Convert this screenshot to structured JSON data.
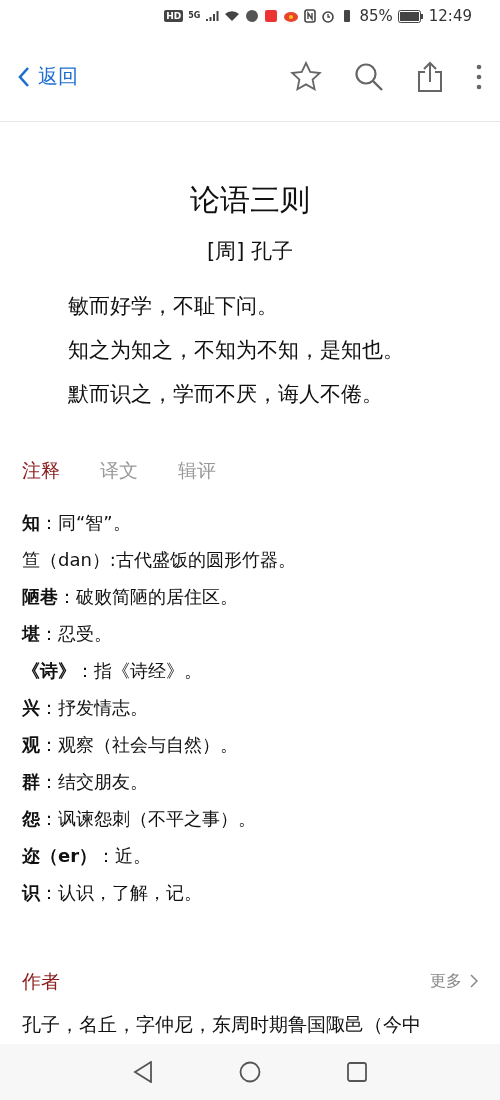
{
  "status_bar": {
    "badge": "HD",
    "network": "5G",
    "battery": "85%",
    "time": "12:49"
  },
  "header": {
    "back": "返回"
  },
  "poem": {
    "title": "论语三则",
    "author": "[周] 孔子",
    "lines": [
      "敏而好学，不耻下问。",
      "知之为知之，不知为不知，是知也。",
      "默而识之，学而不厌，诲人不倦。"
    ]
  },
  "tabs": [
    {
      "label": "注释",
      "selected": true
    },
    {
      "label": "译文",
      "selected": false
    },
    {
      "label": "辑评",
      "selected": false
    }
  ],
  "notes": [
    "**知**：同“智”。",
    "笪（dan）:古代盛饭的圆形竹器。",
    "**陋巷**：破败简陋的居住区。",
    "**堪**：忍受。",
    "**《诗》**：指《诗经》。",
    "**兴**：抒发情志。",
    "**观**：观察（社会与自然）。",
    "**群**：结交朋友。",
    "**怨**：讽谏怨刺（不平之事）。",
    "**迩（er）**：近。",
    "**识**：认识，了解，记。"
  ],
  "author_section": {
    "heading": "作者",
    "more": "更多",
    "text": "孔子，名丘，字仲尼，东周时期鲁国陬邑（今中"
  }
}
